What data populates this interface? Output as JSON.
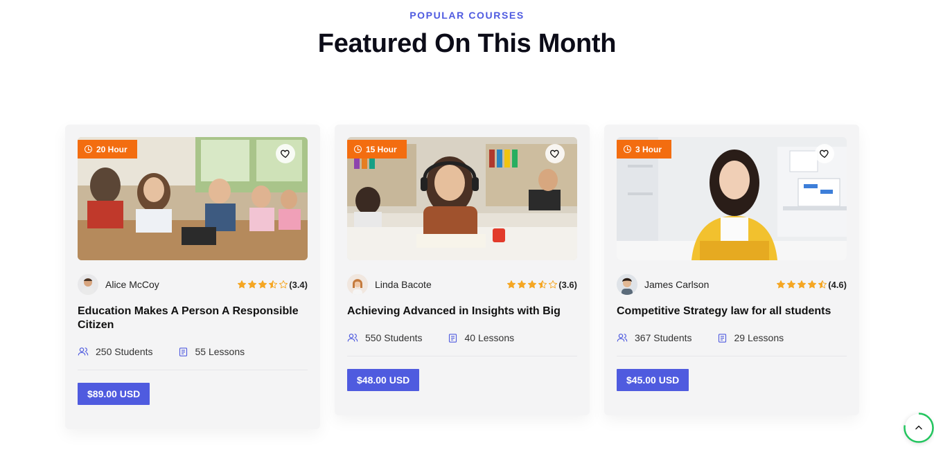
{
  "header": {
    "eyebrow": "POPULAR COURSES",
    "title": "Featured On This Month"
  },
  "courses": [
    {
      "hours": "20 Hour",
      "author": "Alice McCoy",
      "rating_value": 3.4,
      "rating_text": "(3.4)",
      "title": "Education Makes A Person A Responsible Citizen",
      "students": "250 Students",
      "lessons": "55 Lessons",
      "price": "$89.00 USD"
    },
    {
      "hours": "15 Hour",
      "author": "Linda Bacote",
      "rating_value": 3.6,
      "rating_text": "(3.6)",
      "title": "Achieving Advanced in Insights with Big",
      "students": "550 Students",
      "lessons": "40 Lessons",
      "price": "$48.00 USD"
    },
    {
      "hours": "3 Hour",
      "author": "James Carlson",
      "rating_value": 4.6,
      "rating_text": "(4.6)",
      "title": "Competitive Strategy law for all students",
      "students": "367 Students",
      "lessons": "29 Lessons",
      "price": "$45.00 USD"
    }
  ],
  "colors": {
    "accent": "#4f5bdf",
    "badge": "#f36d10",
    "star": "#f5a623",
    "progress": "#22c55e"
  },
  "icons": {
    "clock": "clock-icon",
    "heart": "heart-icon",
    "students": "users-icon",
    "lessons": "document-icon",
    "scroll_top": "chevron-up-icon"
  }
}
